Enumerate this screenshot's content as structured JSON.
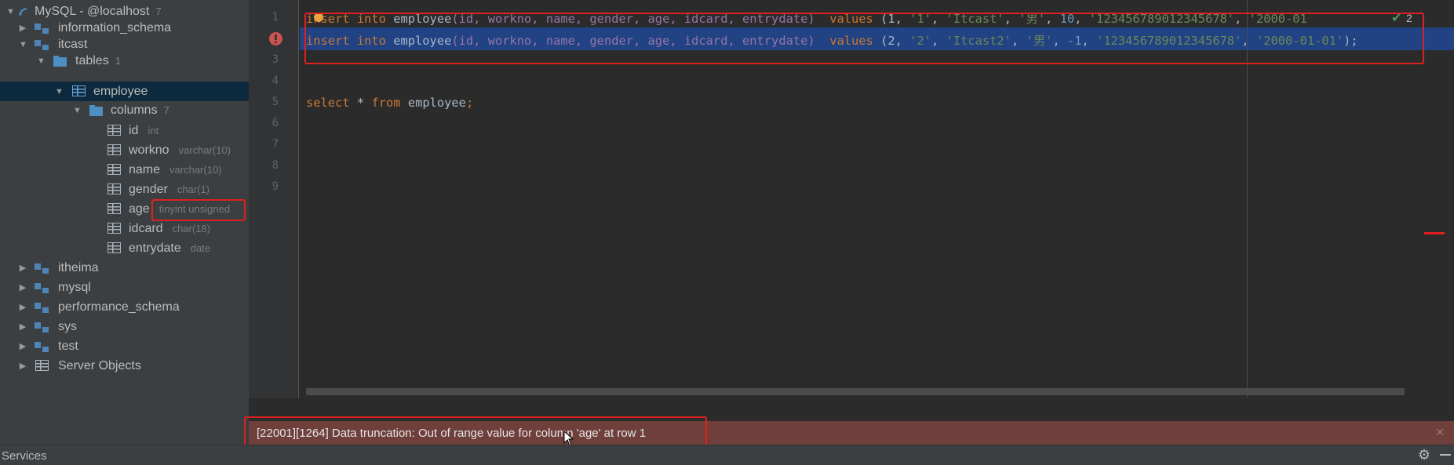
{
  "tree": {
    "root": {
      "label": "MySQL - @localhost",
      "count": "7"
    },
    "schemas_top": [
      {
        "label": "information_schema"
      },
      {
        "label": "itcast"
      }
    ],
    "tables_node": {
      "label": "tables",
      "count": "1"
    },
    "employee": {
      "label": "employee"
    },
    "columns_node": {
      "label": "columns",
      "count": "7"
    },
    "columns": [
      {
        "name": "id",
        "type": "int"
      },
      {
        "name": "workno",
        "type": "varchar(10)"
      },
      {
        "name": "name",
        "type": "varchar(10)"
      },
      {
        "name": "gender",
        "type": "char(1)"
      },
      {
        "name": "age",
        "type": "tinyint unsigned"
      },
      {
        "name": "idcard",
        "type": "char(18)"
      },
      {
        "name": "entrydate",
        "type": "date"
      }
    ],
    "schemas_bottom": [
      {
        "label": "itheima"
      },
      {
        "label": "mysql"
      },
      {
        "label": "performance_schema"
      },
      {
        "label": "sys"
      },
      {
        "label": "test"
      },
      {
        "label": "Server Objects"
      }
    ]
  },
  "editor": {
    "line_numbers": [
      "1",
      "2",
      "3",
      "4",
      "5",
      "6",
      "7",
      "8",
      "9"
    ],
    "line1": {
      "kw1": "insert into",
      "table": "employee",
      "cols": "(id, workno, name, gender, age, idcard, entrydate)",
      "kw2": "values",
      "vals_a": "(1, ",
      "s1": "'1'",
      "sep1": ", ",
      "s2": "'Itcast'",
      "sep2": ", ",
      "s3": "'男'",
      "sep3": ", ",
      "n1": "10",
      "sep4": ", ",
      "s4": "'123456789012345678'",
      "sep5": ", ",
      "s5": "'2000-01"
    },
    "line2": {
      "kw1": "insert into",
      "table": "employee",
      "cols": "(id, workno, name, gender, age, idcard, entrydate)",
      "kw2": "values",
      "vals_a": "(2, ",
      "s1": "'2'",
      "sep1": ", ",
      "s2": "'Itcast2'",
      "sep2": ", ",
      "s3": "'男'",
      "sep3": ", ",
      "n1": "-1",
      "sep4": ", ",
      "s4": "'123456789012345678'",
      "sep5": ", ",
      "s5": "'2000-01-01'",
      "end": ");"
    },
    "line5": {
      "kw1": "select",
      "star": "*",
      "kw2": "from",
      "table": "employee",
      "end": ";"
    },
    "check_count": "2"
  },
  "error": {
    "message": "[22001][1264] Data truncation: Out of range value for column 'age' at row 1",
    "close_glyph": "✕"
  },
  "statusbar": {
    "label": "Services"
  },
  "colors": {
    "error_bar": "#6e3f3b",
    "highlight_box": "#e02020",
    "selection": "#214283"
  }
}
